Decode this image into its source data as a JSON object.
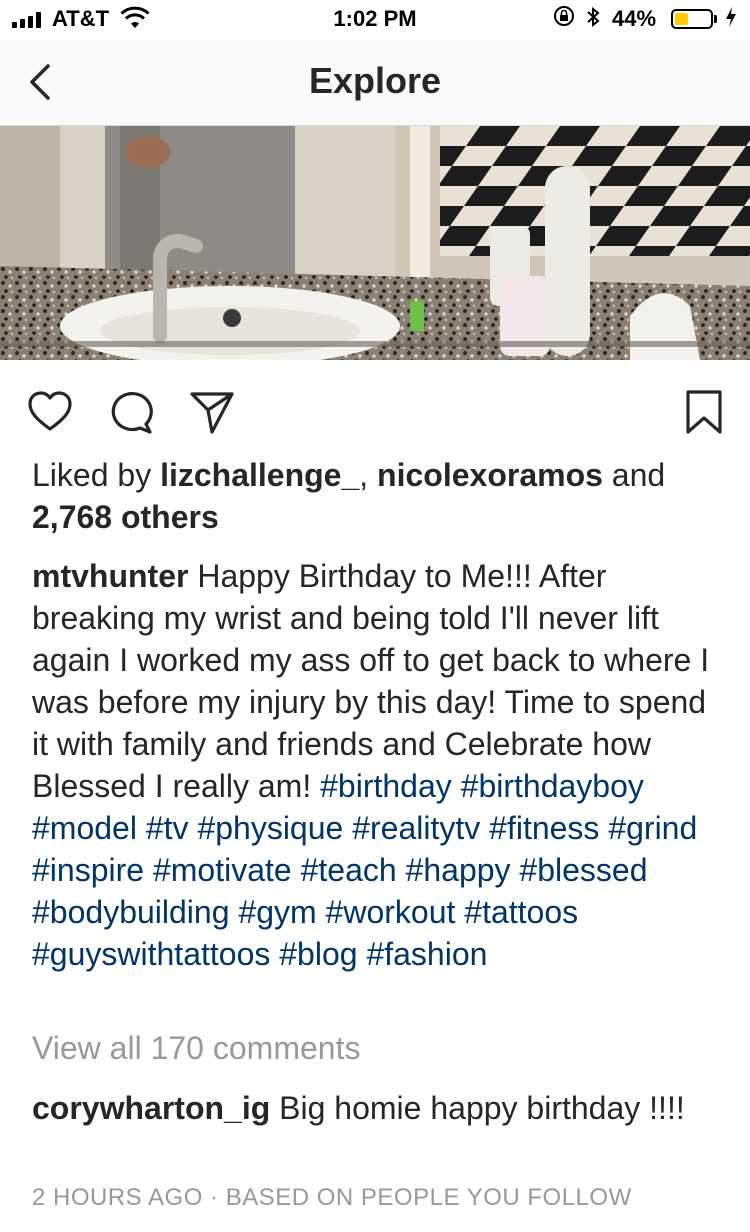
{
  "status_bar": {
    "carrier": "AT&T",
    "time": "1:02 PM",
    "battery_percent": "44%",
    "battery_level": 0.44,
    "battery_color": "#ffcc00"
  },
  "nav": {
    "title": "Explore",
    "back_icon": "chevron-left-icon"
  },
  "actions": {
    "icons": [
      "heart-icon",
      "comment-icon",
      "share-icon",
      "bookmark-icon"
    ]
  },
  "likes": {
    "prefix": "Liked by",
    "user1": "lizchallenge_",
    "separator": ",",
    "user2": "nicolexoramos",
    "and": "and",
    "others": "2,768 others"
  },
  "caption": {
    "username": "mtvhunter",
    "text": "Happy Birthday to Me!!! After breaking my wrist and being told I'll never lift again I worked my ass off to get back to where I was before my injury by this day! Time to spend it with family and friends and Celebrate how Blessed I really am!",
    "hashtags": [
      "#birthday",
      "#birthdayboy",
      "#model",
      "#tv",
      "#physique",
      "#realitytv",
      "#fitness",
      "#grind",
      "#inspire",
      "#motivate",
      "#teach",
      "#happy",
      "#blessed",
      "#bodybuilding",
      "#gym",
      "#workout",
      "#tattoos",
      "#guyswithtattoos",
      "#blog",
      "#fashion"
    ]
  },
  "comments": {
    "view_all": "View all 170 comments",
    "items": [
      {
        "username": "corywharton_ig",
        "text": "Big homie happy birthday !!!!"
      }
    ]
  },
  "meta": {
    "time_ago": "2 HOURS AGO",
    "dot": "·",
    "reason": "BASED ON PEOPLE YOU FOLLOW"
  },
  "colors": {
    "hashtag": "#003569",
    "muted": "#999999",
    "text": "#262626"
  }
}
